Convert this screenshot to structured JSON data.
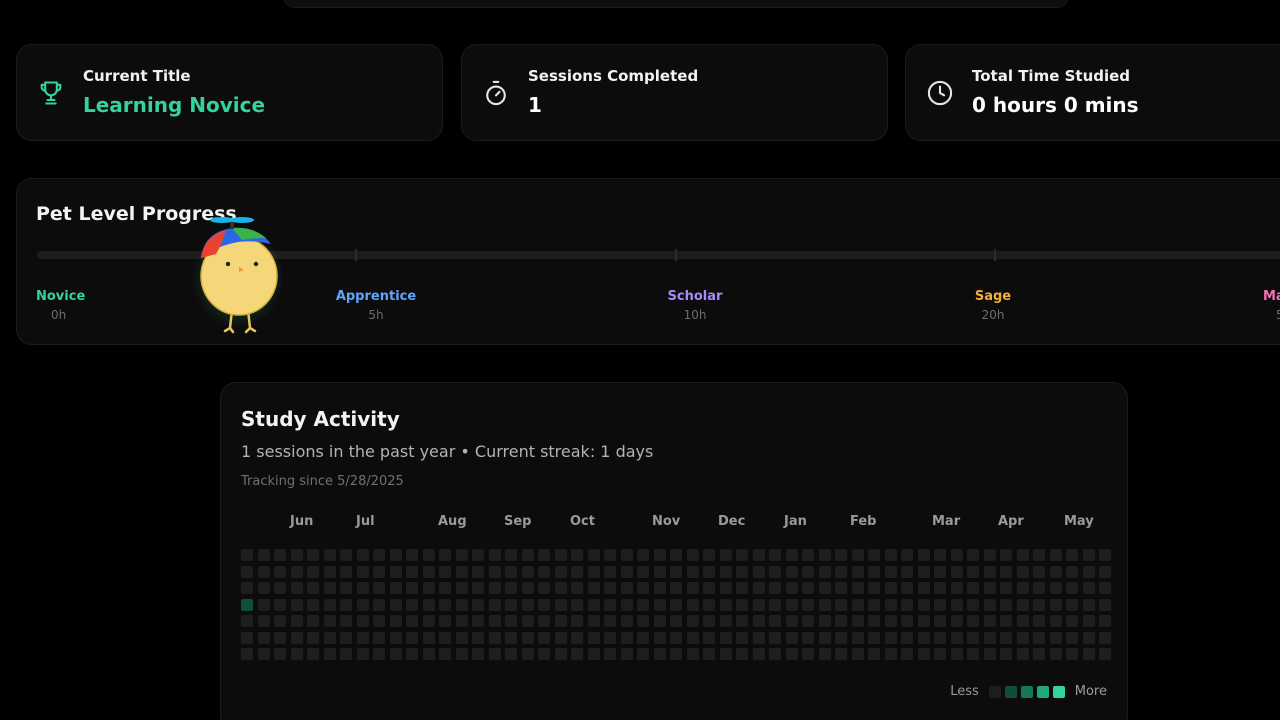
{
  "cards": [
    {
      "label": "Current Title",
      "value": "Learning Novice",
      "icon": "trophy-icon"
    },
    {
      "label": "Sessions Completed",
      "value": "1",
      "icon": "stopwatch-icon"
    },
    {
      "label": "Total Time Studied",
      "value": "0 hours 0 mins",
      "icon": "clock-icon"
    }
  ],
  "colors": {
    "accent": "#34d399",
    "novice": "#34d399",
    "apprentice": "#60a5fa",
    "scholar": "#a78bfa",
    "sage": "#f6ad3b",
    "master": "#f472b6"
  },
  "pet": {
    "title": "Pet Level Progress",
    "levels": [
      {
        "name": "Novice",
        "hours": "0h"
      },
      {
        "name": "Apprentice",
        "hours": "5h"
      },
      {
        "name": "Scholar",
        "hours": "10h"
      },
      {
        "name": "Sage",
        "hours": "20h"
      },
      {
        "name": "Ma",
        "hours": "5"
      }
    ]
  },
  "activity": {
    "title": "Study Activity",
    "subtitle": "1 sessions in the past year • Current streak: 1 days",
    "since": "Tracking since 5/28/2025",
    "months": [
      "Jun",
      "Jul",
      "Aug",
      "Sep",
      "Oct",
      "Nov",
      "Dec",
      "Jan",
      "Feb",
      "Mar",
      "Apr",
      "May"
    ],
    "legend_less": "Less",
    "legend_more": "More",
    "legend_colors": [
      "#1e1e1e",
      "#0f4f3a",
      "#17775a",
      "#22a878",
      "#34d399"
    ]
  }
}
